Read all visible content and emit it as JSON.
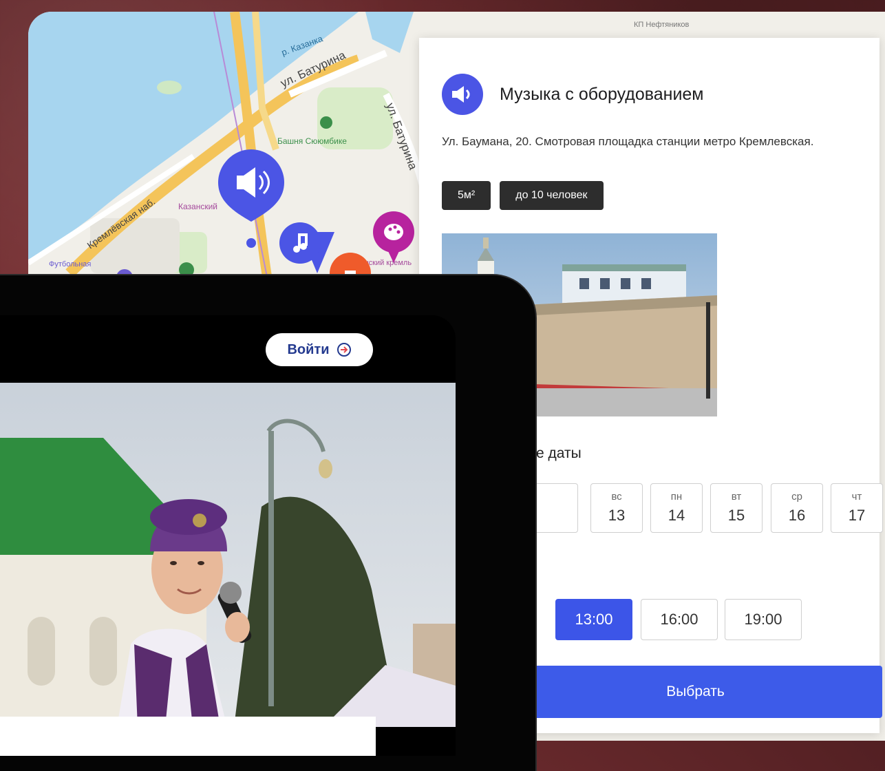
{
  "map": {
    "labels": {
      "river": "р. Казанка",
      "street_baturina": "ул. Батурина",
      "street_baturina_vertical": "ул. Батурина",
      "tower": "Башня Сююмбике",
      "embankment": "Кремлёвская наб.",
      "kazan": "Казанский",
      "kremlin": "Казанский кремль",
      "football": "Футбольная",
      "station": "КП Нефтяников"
    },
    "markers": [
      {
        "icon": "speaker-icon",
        "color": "#4b55e5",
        "selected": true
      },
      {
        "icon": "music-note-icon",
        "color": "#4b55e5"
      },
      {
        "icon": "palette-icon",
        "color": "#b7239e"
      },
      {
        "icon": "generic-marker-icon",
        "color": "#ef5b2b"
      }
    ]
  },
  "panel": {
    "title": "Музыка с оборудованием",
    "icon": "speaker-icon",
    "accent": "#4b55e5",
    "address": "Ул. Баумана, 20. Смотровая площадка станции метро Кремлевская.",
    "chips": [
      "5м²",
      "до 10 человек"
    ],
    "dates_label": "е даты",
    "dates": [
      {
        "dow": "",
        "num": ""
      },
      {
        "dow": "вс",
        "num": "13"
      },
      {
        "dow": "пн",
        "num": "14"
      },
      {
        "dow": "вт",
        "num": "15"
      },
      {
        "dow": "ср",
        "num": "16"
      },
      {
        "dow": "чт",
        "num": "17"
      }
    ],
    "times": [
      {
        "label": "13:00",
        "selected": true
      },
      {
        "label": "16:00",
        "selected": false
      },
      {
        "label": "19:00",
        "selected": false
      }
    ],
    "choose_label": "Выбрать",
    "button_color": "#3d5be9"
  },
  "tablet": {
    "login_label": "Войти",
    "login_icon": "logout-icon"
  }
}
